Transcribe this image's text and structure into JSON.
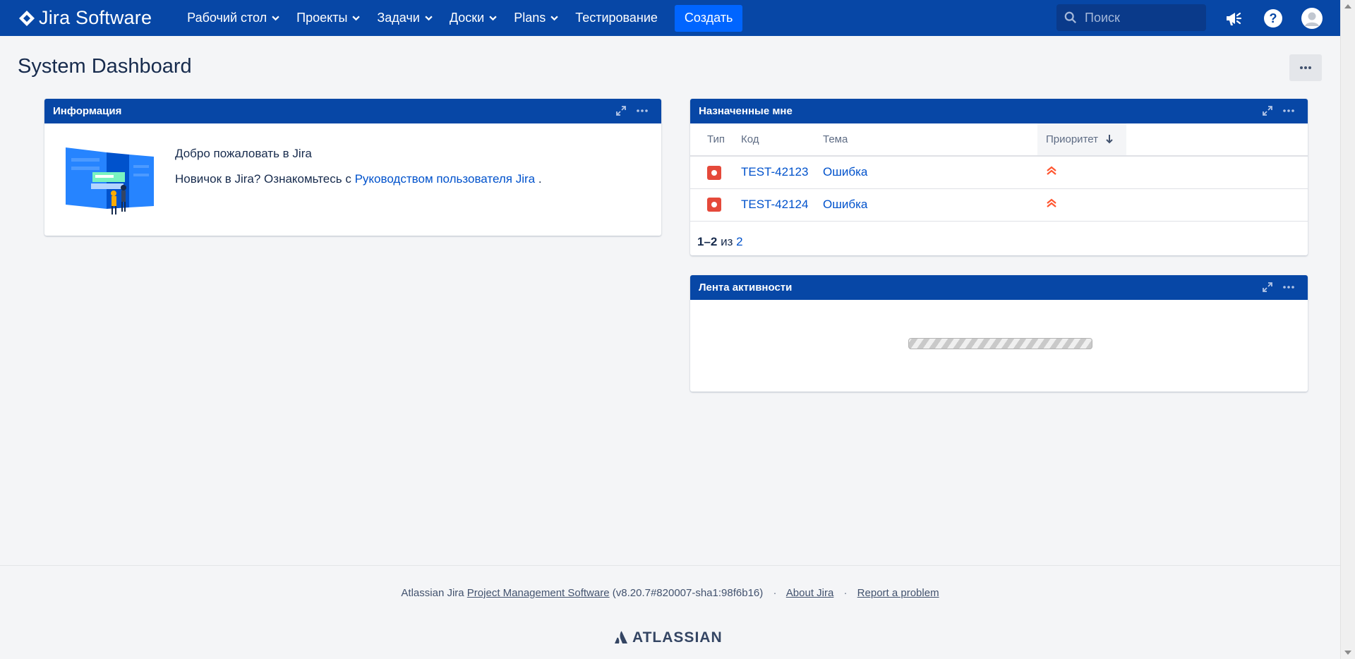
{
  "header": {
    "logo_text": "Jira Software",
    "nav": [
      {
        "label": "Рабочий стол",
        "dropdown": true
      },
      {
        "label": "Проекты",
        "dropdown": true
      },
      {
        "label": "Задачи",
        "dropdown": true
      },
      {
        "label": "Доски",
        "dropdown": true
      },
      {
        "label": "Plans",
        "dropdown": true
      },
      {
        "label": "Тестирование",
        "dropdown": false
      }
    ],
    "create_label": "Создать",
    "search_placeholder": "Поиск",
    "icons": [
      "megaphone-icon",
      "help-icon",
      "avatar-icon"
    ],
    "brand_color": "#0747a6"
  },
  "page": {
    "title": "System Dashboard"
  },
  "info_gadget": {
    "title": "Информация",
    "welcome": "Добро пожаловать в Jira",
    "newbie_prefix": "Новичок в Jira? Ознакомьтесь с",
    "guide_link": "Руководством пользователя Jira",
    "newbie_suffix": "."
  },
  "assigned_gadget": {
    "title": "Назначенные мне",
    "columns": {
      "type": "Тип",
      "key": "Код",
      "summary": "Тема",
      "priority": "Приоритет"
    },
    "rows": [
      {
        "type_icon": "bug-icon",
        "key": "TEST-42123",
        "summary": "Ошибка",
        "priority_icon": "priority-highest-icon"
      },
      {
        "type_icon": "bug-icon",
        "key": "TEST-42124",
        "summary": "Ошибка",
        "priority_icon": "priority-highest-icon"
      }
    ],
    "pager": {
      "range": "1–2",
      "of": "из",
      "total": "2"
    }
  },
  "activity_gadget": {
    "title": "Лента активности"
  },
  "footer": {
    "prefix": "Atlassian Jira",
    "pm_link": "Project Management Software",
    "version": "(v8.20.7#820007-sha1:98f6b16)",
    "sep": "·",
    "about": "About Jira",
    "report": "Report a problem",
    "brand": "ATLASSIAN"
  }
}
